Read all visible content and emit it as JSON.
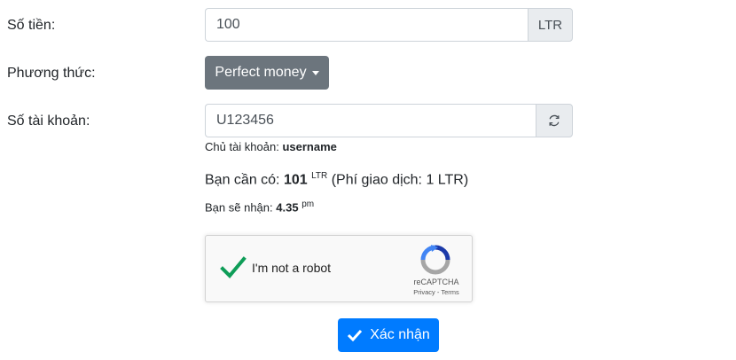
{
  "form": {
    "amount": {
      "label": "Số tiền:",
      "value": "100",
      "unit": "LTR"
    },
    "method": {
      "label": "Phương thức:",
      "selected": "Perfect money"
    },
    "account": {
      "label": "Số tài khoản:",
      "value": "U123456",
      "owner_label": "Chủ tài khoản:",
      "owner_name": "username"
    },
    "summary": {
      "need_label": "Bạn cần có:",
      "need_amount": "101",
      "need_unit": "LTR",
      "fee_text": "(Phí giao dịch: 1 LTR)",
      "receive_label": "Bạn sẽ nhận:",
      "receive_amount": "4.35",
      "receive_unit": "pm"
    },
    "captcha": {
      "label": "I'm not a robot",
      "brand": "reCAPTCHA",
      "links": "Privacy - Terms"
    },
    "submit_label": "Xác nhận"
  },
  "colors": {
    "primary": "#007bff",
    "secondary": "#6c757d",
    "check": "#0f9d58"
  }
}
